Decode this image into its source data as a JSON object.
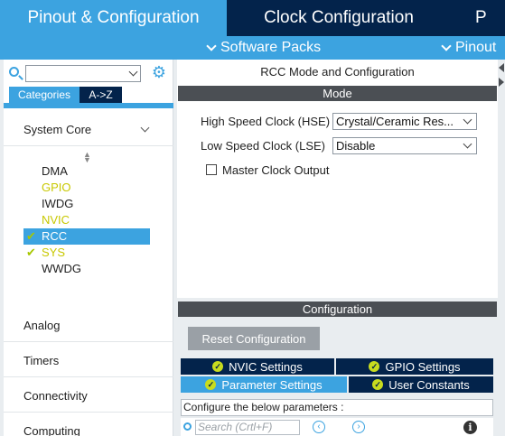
{
  "top_tabs": {
    "pinout": "Pinout & Configuration",
    "clock": "Clock Configuration",
    "third": "P"
  },
  "sub_bar": {
    "software_packs": "Software Packs",
    "pinout": "Pinout"
  },
  "left_panel": {
    "search": {
      "value": "",
      "placeholder": ""
    },
    "category_tabs": [
      "Categories",
      "A->Z"
    ],
    "sections": {
      "system_core": "System Core",
      "analog": "Analog",
      "timers": "Timers",
      "connectivity": "Connectivity",
      "computing": "Computing"
    },
    "peripherals": [
      {
        "name": "DMA",
        "state": "normal",
        "checked": false
      },
      {
        "name": "GPIO",
        "state": "warning",
        "checked": false
      },
      {
        "name": "IWDG",
        "state": "normal",
        "checked": false
      },
      {
        "name": "NVIC",
        "state": "warning",
        "checked": false
      },
      {
        "name": "RCC",
        "state": "selected",
        "checked": true
      },
      {
        "name": "SYS",
        "state": "warning",
        "checked": true
      },
      {
        "name": "WWDG",
        "state": "normal",
        "checked": false
      }
    ]
  },
  "right_panel": {
    "title": "RCC Mode and Configuration",
    "mode_header": "Mode",
    "hse_label": "High Speed Clock (HSE)",
    "hse_value": "Crystal/Ceramic Res...",
    "lse_label": "Low Speed Clock (LSE)",
    "lse_value": "Disable",
    "mco_label": "Master Clock Output",
    "mco_checked": false,
    "config_header": "Configuration",
    "reset_button": "Reset Configuration",
    "param_tabs": {
      "nvic": "NVIC Settings",
      "gpio": "GPIO Settings",
      "parameter": "Parameter Settings",
      "user_constants": "User Constants"
    },
    "configure_text": "Configure the below parameters :",
    "search_placeholder": "Search (Crtl+F)"
  },
  "colors": {
    "accent": "#3ca3e0",
    "dark_navy": "#03234b",
    "section_bar": "#4b4f54",
    "warning_yellow": "#c8c800",
    "check_green": "#a7c700"
  }
}
